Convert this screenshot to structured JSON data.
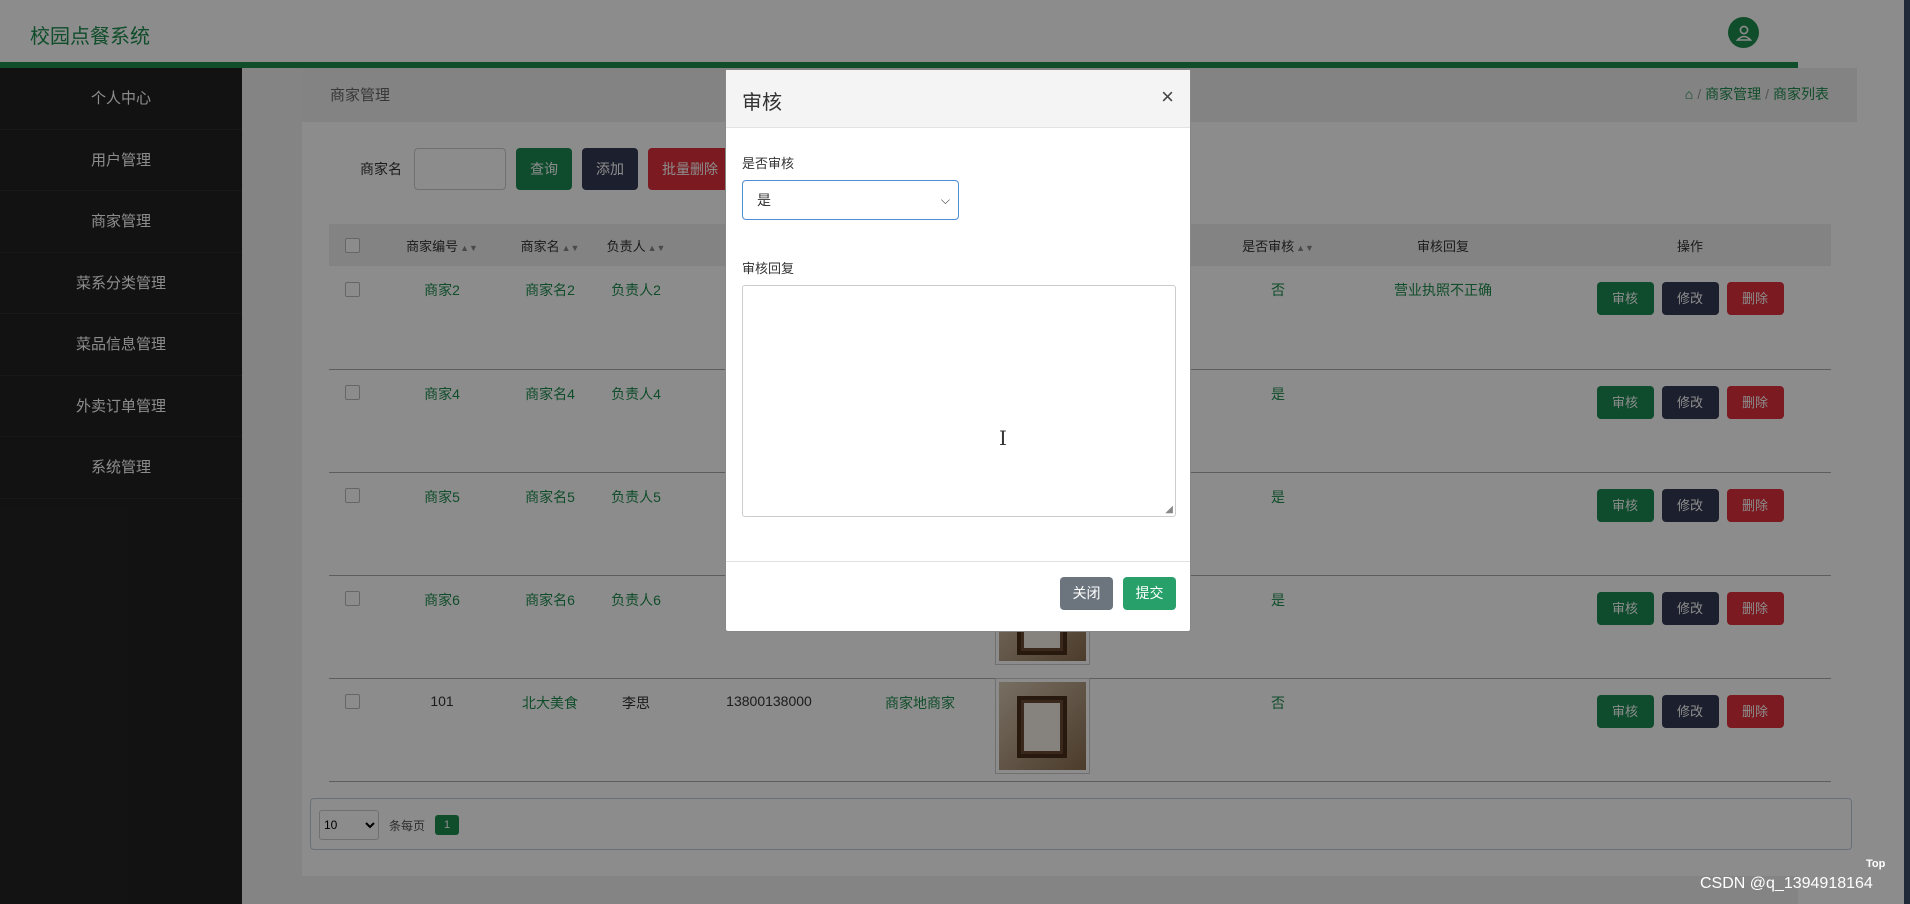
{
  "app": {
    "title": "校园点餐系统"
  },
  "sidebar": {
    "items": [
      {
        "label": "个人中心"
      },
      {
        "label": "用户管理"
      },
      {
        "label": "商家管理"
      },
      {
        "label": "菜系分类管理"
      },
      {
        "label": "菜品信息管理"
      },
      {
        "label": "外卖订单管理"
      },
      {
        "label": "系统管理"
      }
    ]
  },
  "breadcrumb": {
    "title": "商家管理",
    "path": [
      "商家管理",
      "商家列表"
    ]
  },
  "search": {
    "label": "商家名",
    "value": "",
    "query": "查询",
    "add": "添加",
    "batch_delete": "批量删除"
  },
  "table": {
    "headers": [
      "商家编号",
      "商家名",
      "负责人",
      "是否审核",
      "审核回复",
      "操作"
    ],
    "rows": [
      {
        "id": "商家2",
        "name": "商家名2",
        "owner": "负责人2",
        "phone": "",
        "addr": "",
        "audit": "否",
        "reply": "营业执照不正确"
      },
      {
        "id": "商家4",
        "name": "商家名4",
        "owner": "负责人4",
        "phone": "",
        "addr": "",
        "audit": "是",
        "reply": ""
      },
      {
        "id": "商家5",
        "name": "商家名5",
        "owner": "负责人5",
        "phone": "",
        "addr": "",
        "audit": "是",
        "reply": ""
      },
      {
        "id": "商家6",
        "name": "商家名6",
        "owner": "负责人6",
        "phone": "",
        "addr": "",
        "audit": "是",
        "reply": ""
      },
      {
        "id": "101",
        "name": "北大美食",
        "owner": "李思",
        "phone": "13800138000",
        "addr": "商家地商家",
        "audit": "否",
        "reply": ""
      }
    ],
    "actions": {
      "audit": "审核",
      "edit": "修改",
      "delete": "删除"
    }
  },
  "pager": {
    "page_size": "10",
    "per_page_label": "条每页",
    "current_page": "1"
  },
  "modal": {
    "title": "审核",
    "close_glyph": "×",
    "audit_label": "是否审核",
    "audit_value": "是",
    "reply_label": "审核回复",
    "reply_value": "",
    "close_button": "关闭",
    "submit_button": "提交"
  },
  "footer": {
    "top_label": "Top",
    "watermark": "CSDN @q_1394918164"
  }
}
